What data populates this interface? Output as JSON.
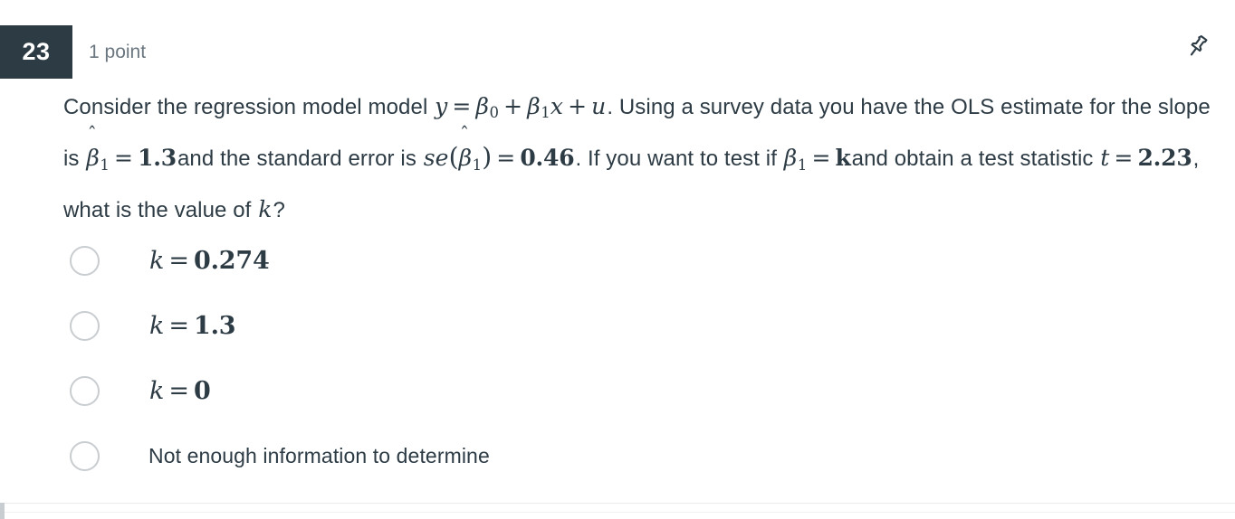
{
  "question": {
    "number": "23",
    "points_label": "1 point",
    "flag_icon": "push-pin-icon",
    "badge_color": "#2D3B45",
    "points_color": "#6b7780",
    "prompt_lines": [
      "Consider the regression model model",
      "Using a survey data you have the OLS estimate for the slope is",
      "and the standard error is",
      "If you want to test if",
      "and obtain a test statistic",
      ", what is the value of"
    ],
    "math": {
      "model_y": "y",
      "model_eq": "=",
      "beta0": "β",
      "beta0_sub": "0",
      "plus": "+",
      "beta1": "β",
      "beta1_sub": "1",
      "x": "x",
      "u": "u",
      "period": ".",
      "hat": "ˆ",
      "slope_value": "1.3",
      "se_name": "se",
      "se_value": "0.46",
      "k": "k",
      "t": "t",
      "t_value": "2.23",
      "question_mark": "?"
    },
    "options": [
      {
        "id": "opt-1",
        "kind": "math",
        "lhs": "k",
        "eq": "=",
        "value": "0.274",
        "selected": false
      },
      {
        "id": "opt-2",
        "kind": "math",
        "lhs": "k",
        "eq": "=",
        "value": "1.3",
        "selected": false
      },
      {
        "id": "opt-3",
        "kind": "math",
        "lhs": "k",
        "eq": "=",
        "value": "0",
        "selected": false
      },
      {
        "id": "opt-4",
        "kind": "text",
        "label": "Not enough information to determine",
        "selected": false
      }
    ]
  },
  "text_fragments": {
    "l1_a": "Consider the regression model model",
    "l1_b": ". Using a survey data you have the",
    "l2_a": "OLS estimate for the slope is",
    "l2_b": "and the standard error is",
    "l2_c": ". If you",
    "l3_a": "want to test if",
    "l3_b": "and obtain a test statistic",
    "l3_c": ", what is the value of"
  }
}
